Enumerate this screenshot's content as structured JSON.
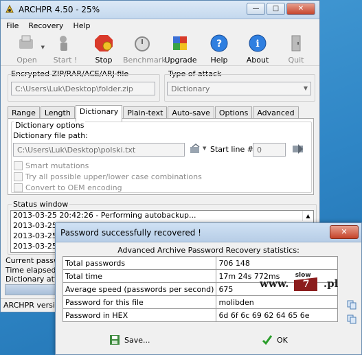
{
  "window": {
    "title": "ARCHPR 4.50 - 25%",
    "controls": {
      "minimize": "—",
      "maximize": "□",
      "close": "✕"
    }
  },
  "menu": [
    "File",
    "Recovery",
    "Help"
  ],
  "toolbar": [
    {
      "label": "Open",
      "icon": "open-icon",
      "enabled": false
    },
    {
      "label": "Start !",
      "icon": "start-icon",
      "enabled": false
    },
    {
      "label": "Stop",
      "icon": "stop-icon",
      "enabled": true
    },
    {
      "label": "Benchmark",
      "icon": "benchmark-icon",
      "enabled": false
    },
    {
      "label": "Upgrade",
      "icon": "upgrade-icon",
      "enabled": true
    },
    {
      "label": "Help",
      "icon": "help-icon",
      "enabled": true
    },
    {
      "label": "About",
      "icon": "about-icon",
      "enabled": true
    },
    {
      "label": "Quit",
      "icon": "quit-icon",
      "enabled": false
    }
  ],
  "file_group": {
    "label": "Encrypted ZIP/RAR/ACE/ARJ-file",
    "value": "C:\\Users\\Luk\\Desktop\\folder.zip"
  },
  "attack_group": {
    "label": "Type of attack",
    "value": "Dictionary"
  },
  "tabs": [
    "Range",
    "Length",
    "Dictionary",
    "Plain-text",
    "Auto-save",
    "Options",
    "Advanced"
  ],
  "active_tab": "Dictionary",
  "dictionary": {
    "options_label": "Dictionary options",
    "path_label": "Dictionary file path:",
    "path_value": "C:\\Users\\Luk\\Desktop\\polski.txt",
    "start_line_label": "Start line #",
    "start_line_value": "0",
    "checkboxes": [
      {
        "label": "Smart mutations",
        "checked": false
      },
      {
        "label": "Try all possible upper/lower case combinations",
        "checked": false
      },
      {
        "label": "Convert to OEM encoding",
        "checked": false
      }
    ]
  },
  "status": {
    "label": "Status window",
    "lines": [
      "2013-03-25 20:42:26 - Performing autobackup...",
      "2013-03-25 2",
      "2013-03-25 2",
      "2013-03-25 2"
    ]
  },
  "lower": {
    "current_password": "Current passwo",
    "time_elapsed": "Time elapsed:",
    "dictionary_attack": "Dictionary attac",
    "statusbar": "ARCHPR version"
  },
  "dialog": {
    "title": "Password successfully recovered !",
    "heading": "Advanced Archive Password Recovery statistics:",
    "rows": [
      {
        "key": "Total passwords",
        "value": "706 148"
      },
      {
        "key": "Total time",
        "value": "17m 24s 772ms"
      },
      {
        "key": "Average speed (passwords per second)",
        "value": "675"
      },
      {
        "key": "Password for this file",
        "value": "molibden"
      },
      {
        "key": "Password in HEX",
        "value": "6d 6f 6c 69 62 64 65 6e"
      }
    ],
    "save_label": "Save...",
    "ok_label": "OK"
  },
  "watermark": {
    "prefix": "www.",
    "badge_top": "slow",
    "badge_num": "7",
    "suffix": ".pl"
  }
}
